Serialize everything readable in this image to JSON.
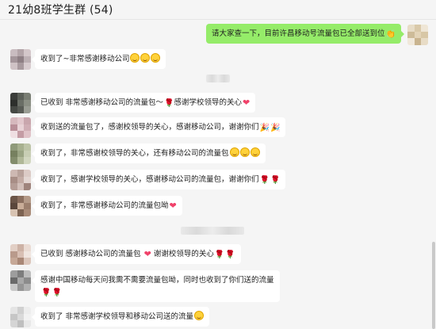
{
  "header": {
    "title": "21幼8班学生群 (54)"
  },
  "messages": [
    {
      "side": "right",
      "text": "请大家查一下，目前许昌移动号流量包已全部送到位",
      "emoji": [
        "clap"
      ]
    },
    {
      "side": "left",
      "text": "收到了~非常感谢移动公司",
      "emoji": [
        "smile",
        "smile",
        "smile"
      ]
    },
    {
      "side": "left",
      "text": "已收到 非常感谢移动公司的流量包～",
      "emoji": [
        "rose"
      ],
      "text2": "感谢学校领导的关心",
      "emoji2": [
        "heart"
      ]
    },
    {
      "side": "left",
      "text": "收到送的流量包了，感谢校领导的关心，感谢移动公司，谢谢你们",
      "emoji": [
        "party",
        "party"
      ]
    },
    {
      "side": "left",
      "text": "收到了，非常感谢校领导的关心，还有移动公司的流量包",
      "emoji": [
        "smile",
        "smile",
        "smile"
      ]
    },
    {
      "side": "left",
      "text": "收到了，感谢学校领导的关心，感谢移动公司的流量包，谢谢你们",
      "emoji": [
        "rose",
        "rose"
      ]
    },
    {
      "side": "left",
      "text": "收到了，非常感谢移动公司的流量包呦",
      "emoji": [
        "heart"
      ]
    },
    {
      "side": "left",
      "text": "已收到 感谢移动公司的流量包",
      "emoji": [
        "heart"
      ],
      "text2": "谢谢校领导的关心",
      "emoji2": [
        "rose",
        "rose"
      ]
    },
    {
      "side": "left",
      "text": "感谢中国移动每天问我需不需要流量包呦，同时也收到了你们送的流量",
      "emoji2": [
        "rose",
        "rose"
      ]
    },
    {
      "side": "left",
      "text": "收到了 非常感谢学校领导和移动公司送的流量",
      "emoji": [
        "smile"
      ]
    }
  ],
  "colors": {
    "bg": "#f5f5f5",
    "bubble_self": "#95ec69",
    "bubble_other": "#ffffff"
  }
}
